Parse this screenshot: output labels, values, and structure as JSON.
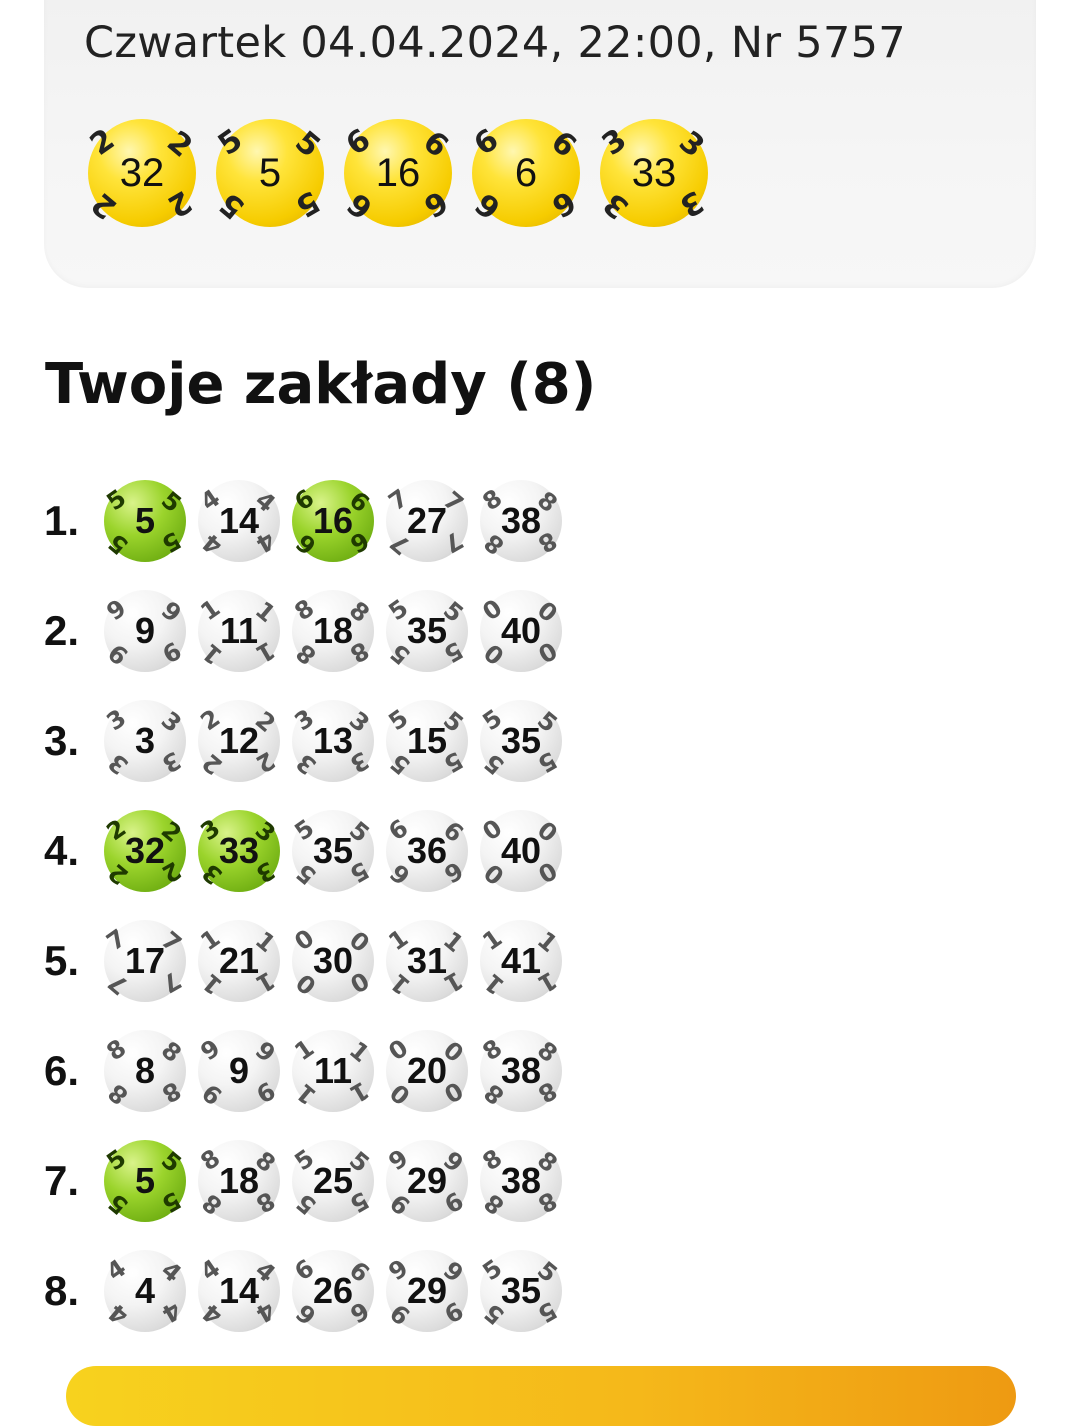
{
  "draw": {
    "title": "Czwartek 04.04.2024, 22:00, Nr 5757",
    "numbers": [
      "32",
      "5",
      "16",
      "6",
      "33"
    ]
  },
  "bets": {
    "title": "Twoje zakłady (8)",
    "rows": [
      {
        "label": "1.",
        "numbers": [
          "5",
          "14",
          "16",
          "27",
          "38"
        ],
        "hits": [
          true,
          false,
          true,
          false,
          false
        ]
      },
      {
        "label": "2.",
        "numbers": [
          "9",
          "11",
          "18",
          "35",
          "40"
        ],
        "hits": [
          false,
          false,
          false,
          false,
          false
        ]
      },
      {
        "label": "3.",
        "numbers": [
          "3",
          "12",
          "13",
          "15",
          "35"
        ],
        "hits": [
          false,
          false,
          false,
          false,
          false
        ]
      },
      {
        "label": "4.",
        "numbers": [
          "32",
          "33",
          "35",
          "36",
          "40"
        ],
        "hits": [
          true,
          true,
          false,
          false,
          false
        ]
      },
      {
        "label": "5.",
        "numbers": [
          "17",
          "21",
          "30",
          "31",
          "41"
        ],
        "hits": [
          false,
          false,
          false,
          false,
          false
        ]
      },
      {
        "label": "6.",
        "numbers": [
          "8",
          "9",
          "11",
          "20",
          "38"
        ],
        "hits": [
          false,
          false,
          false,
          false,
          false
        ]
      },
      {
        "label": "7.",
        "numbers": [
          "5",
          "18",
          "25",
          "29",
          "38"
        ],
        "hits": [
          true,
          false,
          false,
          false,
          false
        ]
      },
      {
        "label": "8.",
        "numbers": [
          "4",
          "14",
          "26",
          "29",
          "35"
        ],
        "hits": [
          false,
          false,
          false,
          false,
          false
        ]
      }
    ]
  },
  "colors": {
    "draw_ball": "#f6cc00",
    "hit_ball": "#8cc820",
    "miss_ball": "#e6e6e6",
    "accent_bar": "#f5b81a"
  },
  "icons": {
    "ball": "lottery-ball-icon"
  }
}
